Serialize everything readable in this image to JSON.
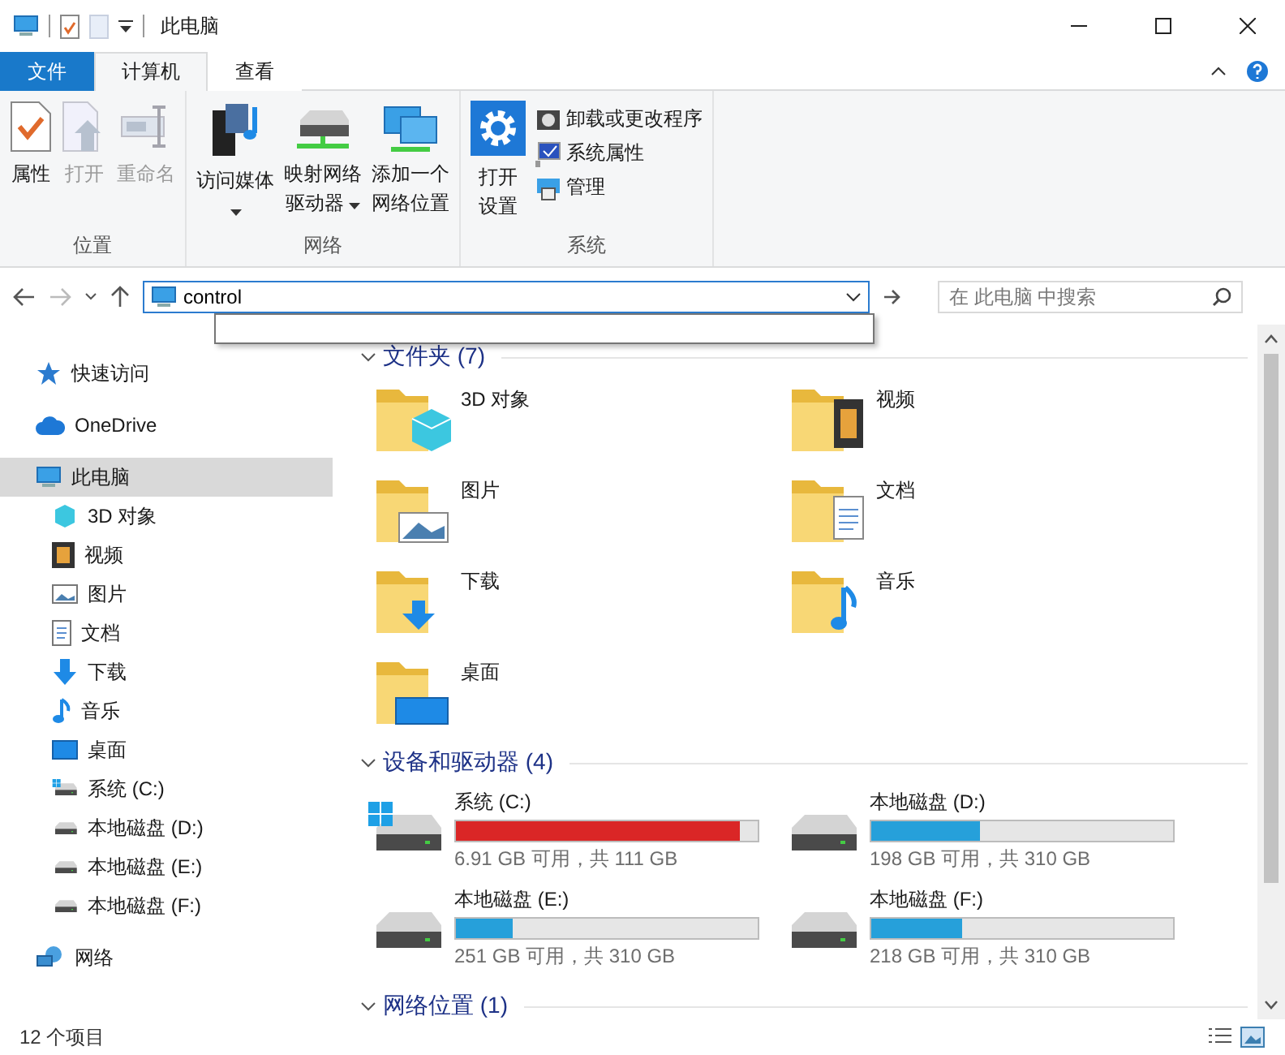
{
  "window": {
    "title": "此电脑"
  },
  "ribbon": {
    "tabs": [
      {
        "label": "文件",
        "kind": "file",
        "selected": false
      },
      {
        "label": "计算机",
        "kind": "tab",
        "selected": true
      },
      {
        "label": "查看",
        "kind": "tab",
        "selected": false
      }
    ],
    "groups": [
      {
        "label": "位置",
        "buttons": [
          {
            "label": "属性",
            "kind": "large",
            "disabled": false,
            "dropdown": false
          },
          {
            "label": "打开",
            "kind": "large",
            "disabled": true,
            "dropdown": false
          },
          {
            "label": "重命名",
            "kind": "large",
            "disabled": true,
            "dropdown": false
          }
        ]
      },
      {
        "label": "网络",
        "buttons": [
          {
            "label": "访问媒体",
            "kind": "large",
            "disabled": false,
            "dropdown": true
          },
          {
            "label": "映射网络驱动器",
            "kind": "large",
            "disabled": false,
            "dropdown": true
          },
          {
            "label": "添加一个网络位置",
            "kind": "large",
            "disabled": false,
            "dropdown": false
          }
        ]
      },
      {
        "label": "系统",
        "buttons": [
          {
            "label": "打开设置",
            "kind": "large",
            "disabled": false,
            "dropdown": false
          },
          {
            "label": "卸载或更改程序",
            "kind": "small",
            "disabled": false,
            "dropdown": false
          },
          {
            "label": "系统属性",
            "kind": "small",
            "disabled": false,
            "dropdown": false
          },
          {
            "label": "管理",
            "kind": "small",
            "disabled": false,
            "dropdown": false
          }
        ]
      }
    ]
  },
  "address": {
    "value": "control"
  },
  "search": {
    "placeholder": "在 此电脑 中搜索"
  },
  "sidebar": {
    "items": [
      {
        "label": "快速访问",
        "selected": false
      },
      {
        "label": "OneDrive",
        "selected": false
      },
      {
        "label": "此电脑",
        "selected": true,
        "children": [
          {
            "label": "3D 对象",
            "selected": false
          },
          {
            "label": "视频",
            "selected": false
          },
          {
            "label": "图片",
            "selected": false
          },
          {
            "label": "文档",
            "selected": false
          },
          {
            "label": "下载",
            "selected": false
          },
          {
            "label": "音乐",
            "selected": false
          },
          {
            "label": "桌面",
            "selected": false
          },
          {
            "label": "系统 (C:)",
            "selected": false
          },
          {
            "label": "本地磁盘 (D:)",
            "selected": false
          },
          {
            "label": "本地磁盘 (E:)",
            "selected": false
          },
          {
            "label": "本地磁盘 (F:)",
            "selected": false
          }
        ]
      },
      {
        "label": "网络",
        "selected": false
      }
    ]
  },
  "sections": [
    {
      "title": "文件夹 (7)",
      "kind": "folders",
      "expanded": true,
      "items": [
        {
          "name": "3D 对象"
        },
        {
          "name": "视频"
        },
        {
          "name": "图片"
        },
        {
          "name": "文档"
        },
        {
          "name": "下载"
        },
        {
          "name": "音乐"
        },
        {
          "name": "桌面"
        }
      ]
    },
    {
      "title": "设备和驱动器 (4)",
      "kind": "drives",
      "expanded": true,
      "items": [
        {
          "name": "系统 (C:)",
          "level": 0.94,
          "low_space": true,
          "free": "6.91 GB 可用，共 111 GB"
        },
        {
          "name": "本地磁盘 (D:)",
          "level": 0.36,
          "low_space": false,
          "free": "198 GB 可用，共 310 GB"
        },
        {
          "name": "本地磁盘 (E:)",
          "level": 0.19,
          "low_space": false,
          "free": "251 GB 可用，共 310 GB"
        },
        {
          "name": "本地磁盘 (F:)",
          "level": 0.3,
          "low_space": false,
          "free": "218 GB 可用，共 310 GB"
        }
      ]
    },
    {
      "title": "网络位置 (1)",
      "kind": "network",
      "expanded": true
    }
  ],
  "status_bar": {
    "count": "12 个项目"
  }
}
